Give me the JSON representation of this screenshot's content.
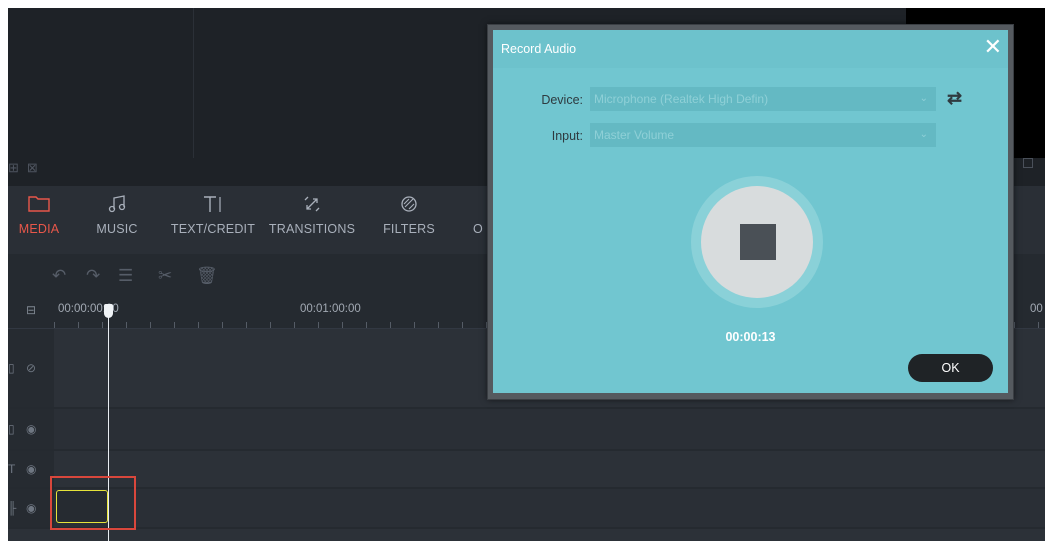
{
  "toolbar": {
    "tabs": [
      {
        "label": "MEDIA",
        "icon": "folder-icon",
        "active": true
      },
      {
        "label": "MUSIC",
        "icon": "music-note-icon",
        "active": false
      },
      {
        "label": "TEXT/CREDIT",
        "icon": "text-icon",
        "active": false
      },
      {
        "label": "TRANSITIONS",
        "icon": "transitions-icon",
        "active": false
      },
      {
        "label": "FILTERS",
        "icon": "filters-icon",
        "active": false
      },
      {
        "label": "O",
        "icon": "",
        "active": false
      }
    ]
  },
  "edit_tools": [
    "undo-icon",
    "redo-icon",
    "adjust-icon",
    "cut-icon",
    "delete-icon"
  ],
  "ruler": {
    "timecodes": [
      "00:00:00:00",
      "00:01:00:00",
      "00"
    ]
  },
  "tracks": [
    "video",
    "pip",
    "text",
    "audio"
  ],
  "dialog": {
    "title": "Record Audio",
    "device_label": "Device:",
    "device_value": "Microphone (Realtek High Defin)",
    "input_label": "Input:",
    "input_value": "Master Volume",
    "timer": "00:00:13",
    "ok_label": "OK"
  },
  "colors": {
    "accent_active": "#e8574a",
    "dialog_teal": "#71c6d0",
    "highlight_box": "#d9473c",
    "clip_outline": "#e6e43a"
  }
}
